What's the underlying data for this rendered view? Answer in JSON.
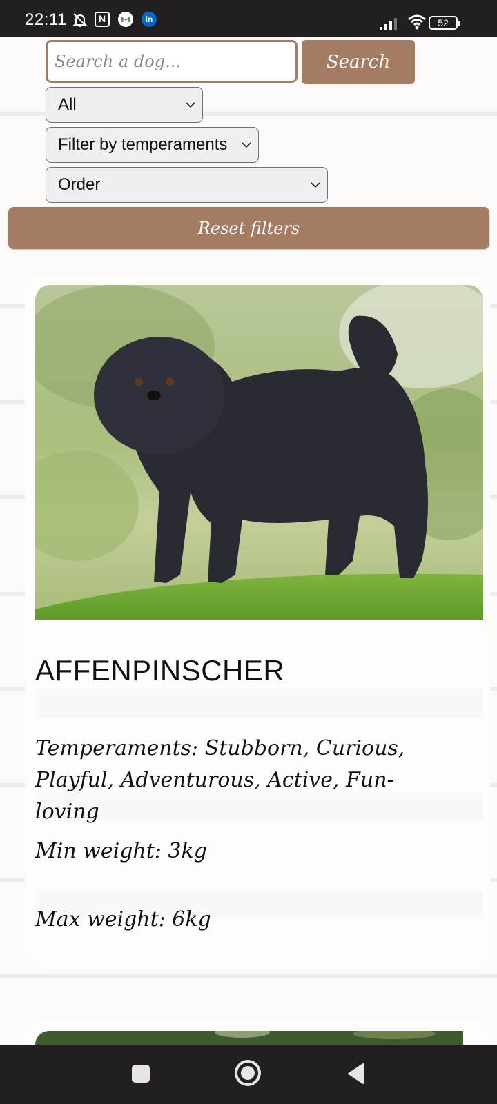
{
  "status_bar": {
    "time": "22:11",
    "nfc_label": "N",
    "linkedin_label": "in",
    "battery": "52",
    "icons": [
      "bell-off-icon",
      "nfc-icon",
      "gmail-icon",
      "linkedin-icon",
      "signal-icon",
      "wifi-icon",
      "battery-icon"
    ]
  },
  "search": {
    "placeholder": "Search a dog...",
    "value": "",
    "button_label": "Search"
  },
  "filters": {
    "breed_select": "All",
    "temperament_select": "Filter by temperaments",
    "order_select": "Order",
    "reset_label": "Reset filters"
  },
  "card": {
    "name": "AFFENPINSCHER",
    "temperaments": "Temperaments: Stubborn, Curious, Playful, Adventurous, Active, Fun-loving",
    "min_weight": "Min weight: 3kg",
    "max_weight": "Max weight: 6kg"
  },
  "nav_bar": {
    "icons": [
      "recents-icon",
      "home-icon",
      "back-icon"
    ]
  },
  "colors": {
    "accent": "#a47b63",
    "status_bar": "#231f20",
    "page_bg": "#fbfaf8"
  }
}
